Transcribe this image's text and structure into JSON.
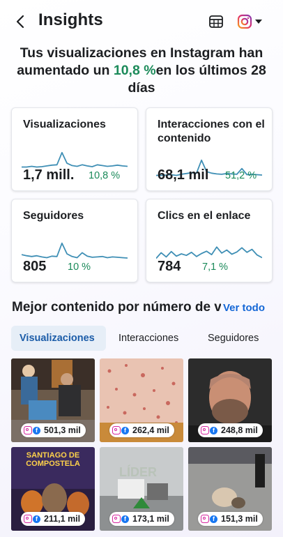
{
  "header": {
    "title": "Insights",
    "back_icon": "chevron-left-icon",
    "calendar_icon": "calendar-icon",
    "account_icon": "instagram-icon",
    "dropdown_icon": "caret-down-icon"
  },
  "headline": {
    "part1": "Tus visualizaciones en Instagram han aumentado un ",
    "highlight": "10,8 %",
    "part2": "en los últimos 28 días"
  },
  "colors": {
    "accent_green": "#1b8a5a",
    "spark_line": "#3f8fb5",
    "link_blue": "#1467d6",
    "active_tab_bg": "#e6eef7"
  },
  "cards": [
    {
      "title": "Visualizaciones",
      "value": "1,7 mill.",
      "change": "10,8 %",
      "trend": [
        3,
        3,
        3.2,
        3,
        3.1,
        3.3,
        3.5,
        3.6,
        6.8,
        4,
        3.4,
        3.2,
        3.6,
        3.3,
        3.1,
        3.6,
        3.4,
        3.2,
        3.3,
        3.5,
        3.3,
        3.2
      ]
    },
    {
      "title": "Interacciones con el contenido",
      "value": "68,1 mil",
      "change": "51,2 %",
      "trend": [
        3,
        3,
        3.1,
        3.2,
        3,
        3.3,
        3.5,
        3.7,
        3.6,
        7,
        4,
        3.6,
        3.4,
        3.3,
        3.5,
        3.4,
        3.3,
        4.8,
        3.2,
        3.3,
        3.2,
        3.1
      ]
    },
    {
      "title": "Seguidores",
      "value": "805",
      "change": "10 %",
      "trend": [
        4,
        3.7,
        3.5,
        3.7,
        3.4,
        3.2,
        3.6,
        3.5,
        7,
        4.2,
        3.5,
        3.2,
        4.5,
        3.6,
        3.3,
        3.4,
        3.5,
        3.2,
        3.4,
        3.3,
        3.2,
        3.1
      ]
    },
    {
      "title": "Clics en el enlace",
      "value": "784",
      "change": "7,1 %",
      "trend": [
        3,
        4.5,
        3.4,
        4.8,
        3.6,
        4.2,
        3.8,
        4.6,
        3.5,
        4.3,
        4.9,
        4,
        6,
        4.4,
        5.2,
        4.1,
        4.7,
        5.8,
        4.6,
        5.4,
        3.9,
        3.2
      ]
    }
  ],
  "best_content": {
    "title": "Mejor contenido por número de visualizaciones",
    "see_all": "Ver todo",
    "tabs": [
      "Visualizaciones",
      "Interacciones",
      "Seguidores"
    ],
    "items": [
      {
        "views": "501,3 mil",
        "caption": ""
      },
      {
        "views": "262,4 mil",
        "caption": ""
      },
      {
        "views": "248,8 mil",
        "caption": ""
      },
      {
        "views": "211,1 mil",
        "caption": "SANTIAGO DE COMPOSTELA"
      },
      {
        "views": "173,1 mil",
        "caption": "LÍDER"
      },
      {
        "views": "151,3 mil",
        "caption": ""
      }
    ]
  }
}
